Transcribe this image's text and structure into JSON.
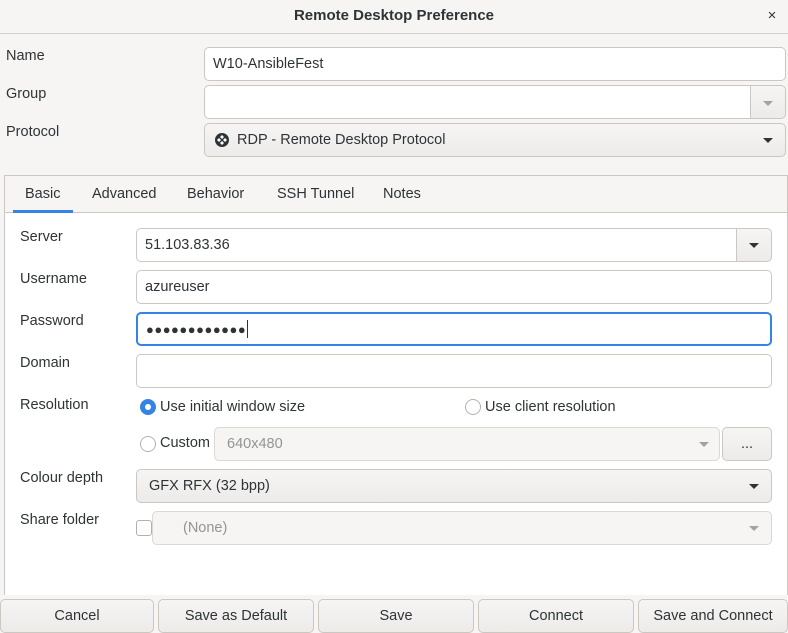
{
  "window": {
    "title": "Remote Desktop Preference",
    "close_glyph": "×"
  },
  "profile": {
    "name_label": "Name",
    "name_value": "W10-AnsibleFest",
    "group_label": "Group",
    "group_value": "",
    "protocol_label": "Protocol",
    "protocol_value": "RDP - Remote Desktop Protocol"
  },
  "tabs": [
    {
      "label": "Basic",
      "active": true
    },
    {
      "label": "Advanced",
      "active": false
    },
    {
      "label": "Behavior",
      "active": false
    },
    {
      "label": "SSH Tunnel",
      "active": false
    },
    {
      "label": "Notes",
      "active": false
    }
  ],
  "basic": {
    "server_label": "Server",
    "server_value": "51.103.83.36",
    "username_label": "Username",
    "username_value": "azureuser",
    "password_label": "Password",
    "password_value": "●●●●●●●●●●●●",
    "domain_label": "Domain",
    "domain_value": "",
    "resolution_label": "Resolution",
    "res_initial": "Use initial window size",
    "res_client": "Use client resolution",
    "res_custom": "Custom",
    "res_custom_value": "640x480",
    "res_more": "...",
    "colour_label": "Colour depth",
    "colour_value": "GFX RFX (32 bpp)",
    "share_label": "Share folder",
    "share_value": "(None)"
  },
  "buttons": {
    "cancel": "Cancel",
    "save_default": "Save as Default",
    "save": "Save",
    "connect": "Connect",
    "save_connect": "Save and Connect"
  },
  "colors": {
    "accent": "#3584e4",
    "border": "#cdc7c2",
    "background": "#f6f5f4"
  }
}
